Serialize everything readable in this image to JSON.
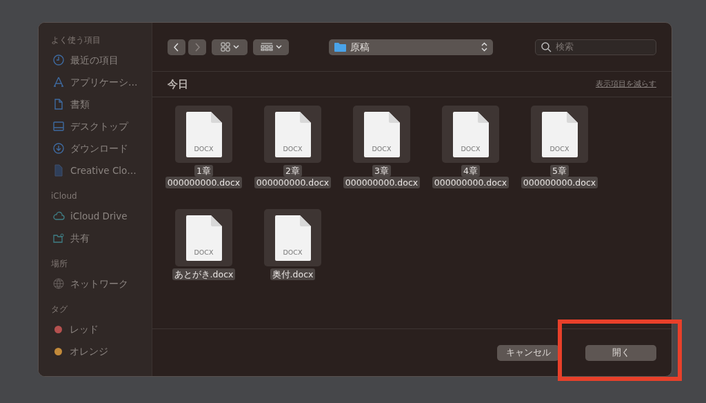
{
  "sidebar": {
    "sections": [
      {
        "heading": "よく使う項目",
        "items": [
          {
            "kind": "clock",
            "label": "最近の項目"
          },
          {
            "kind": "apps",
            "label": "アプリケーシ…"
          },
          {
            "kind": "doc",
            "label": "書類"
          },
          {
            "kind": "desktop",
            "label": "デスクトップ"
          },
          {
            "kind": "download",
            "label": "ダウンロード"
          },
          {
            "kind": "file",
            "label": "Creative Clo…"
          }
        ]
      },
      {
        "heading": "iCloud",
        "items": [
          {
            "kind": "cloud",
            "label": "iCloud Drive"
          },
          {
            "kind": "shared",
            "label": "共有"
          }
        ]
      },
      {
        "heading": "場所",
        "items": [
          {
            "kind": "network",
            "label": "ネットワーク"
          }
        ]
      },
      {
        "heading": "タグ",
        "items": [
          {
            "kind": "tag",
            "label": "レッド",
            "color": "#b5514f"
          },
          {
            "kind": "tag",
            "label": "オレンジ",
            "color": "#c28a3a"
          }
        ]
      }
    ]
  },
  "toolbar": {
    "back": {
      "disabled": false
    },
    "forward": {
      "disabled": true
    },
    "location": "原稿",
    "search": {
      "placeholder": "検索"
    }
  },
  "group": {
    "title": "今日",
    "action": "表示項目を減らす"
  },
  "files": [
    {
      "type": "DOCX",
      "name_lines": [
        "1章",
        "000000000.docx"
      ],
      "selected": true
    },
    {
      "type": "DOCX",
      "name_lines": [
        "2章",
        "000000000.docx"
      ],
      "selected": true
    },
    {
      "type": "DOCX",
      "name_lines": [
        "3章",
        "000000000.docx"
      ],
      "selected": true
    },
    {
      "type": "DOCX",
      "name_lines": [
        "4章",
        "000000000.docx"
      ],
      "selected": true
    },
    {
      "type": "DOCX",
      "name_lines": [
        "5章",
        "000000000.docx"
      ],
      "selected": true
    },
    {
      "type": "DOCX",
      "name_lines": [
        "あとがき.docx"
      ],
      "selected": true
    },
    {
      "type": "DOCX",
      "name_lines": [
        "奥付.docx"
      ],
      "selected": true
    }
  ],
  "buttons": [
    {
      "label": "キャンセル"
    },
    {
      "label": "開く"
    }
  ],
  "annotation": {
    "color": "#e8402a"
  }
}
